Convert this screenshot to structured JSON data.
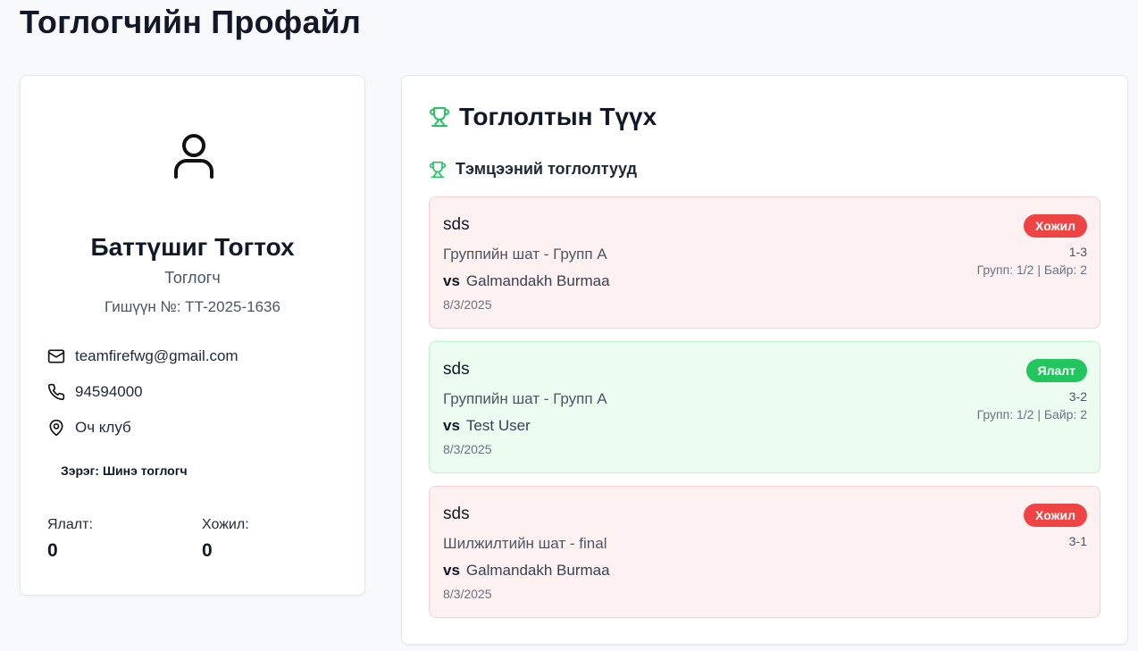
{
  "page": {
    "title": "Тоглогчийн Профайл"
  },
  "profile": {
    "name": "Баттүшиг Тогтох",
    "role": "Тоглогч",
    "member_id": "Гишүүн №: TT-2025-1636",
    "email": "teamfirefwg@gmail.com",
    "phone": "94594000",
    "club": "Оч клуб",
    "rank": "Зэрэг: Шинэ тоглогч",
    "wins_label": "Ялалт:",
    "wins_value": "0",
    "losses_label": "Хожил:",
    "losses_value": "0"
  },
  "history": {
    "title": "Тоглолтын Түүх",
    "section_title": "Тэмцээний тоглолтууд",
    "matches": [
      {
        "tournament": "sds",
        "stage": "Группийн шат - Групп A",
        "vs": "vs",
        "opponent": "Galmandakh Burmaa",
        "date": "8/3/2025",
        "result": "Хожил",
        "score": "1-3",
        "group_info": "Групп: 1/2 | Байр: 2"
      },
      {
        "tournament": "sds",
        "stage": "Группийн шат - Групп A",
        "vs": "vs",
        "opponent": "Test User",
        "date": "8/3/2025",
        "result": "Ялалт",
        "score": "3-2",
        "group_info": "Групп: 1/2 | Байр: 2"
      },
      {
        "tournament": "sds",
        "stage": "Шилжилтийн шат - final",
        "vs": "vs",
        "opponent": "Galmandakh Burmaa",
        "date": "8/3/2025",
        "result": "Хожил",
        "score": "3-1",
        "group_info": ""
      }
    ]
  },
  "icons": {
    "avatar": "user-icon",
    "email": "mail-icon",
    "phone": "phone-icon",
    "club": "map-pin-icon",
    "history": "trophy-icon"
  },
  "colors": {
    "accent_green": "#22c55e",
    "loss_red": "#ef4444",
    "loss_bg": "#fef1f1",
    "win_bg": "#edfcf1"
  }
}
